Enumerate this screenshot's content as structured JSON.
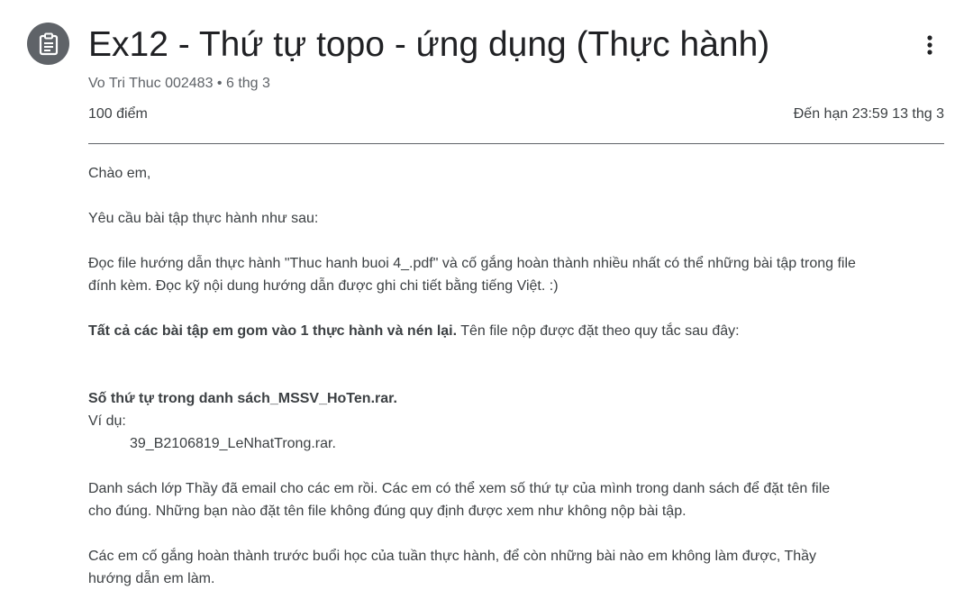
{
  "header": {
    "title": "Ex12 - Thứ tự topo - ứng dụng (Thực hành)",
    "author": "Vo Tri Thuc 002483",
    "separator": "•",
    "date": "6 thg 3",
    "points": "100 điểm",
    "due": "Đến hạn 23:59 13 thg 3",
    "icons": {
      "assignment": "assignment-icon",
      "more": "more-vert-icon"
    }
  },
  "body": {
    "greeting": "Chào em,",
    "request": "Yêu cầu bài tập thực hành như sau:",
    "para1_line1": "Đọc file hướng dẫn thực hành \"Thuc hanh buoi 4_.pdf\" và cố gắng hoàn thành nhiều nhất có thể những bài tập trong file",
    "para1_line2": "đính kèm. Đọc kỹ nội dung hướng dẫn được ghi chi tiết bằng tiếng Việt. :)",
    "para2_bold": "Tất cả các bài tập em gom vào 1 thực hành và nén lại.",
    "para2_rest": " Tên file nộp được đặt theo quy tắc sau đây:",
    "rule": "Số thứ tự trong danh sách_MSSV_HoTen.rar.",
    "example_label": "Ví dụ:",
    "example_value": "39_B2106819_LeNhatTrong.rar.",
    "para3_line1": "Danh sách lớp Thầy đã email cho các em rồi. Các em có thể xem số thứ tự của mình trong danh sách để đặt tên file",
    "para3_line2": "cho đúng. Những bạn nào đặt tên file không đúng quy định được xem như không nộp bài tập.",
    "para4_line1": "Các em cố gắng hoàn thành trước buổi học của tuần thực hành, để còn những bài nào em không làm được, Thầy",
    "para4_line2": "hướng dẫn em làm."
  },
  "colors": {
    "icon_bg": "#5f6368",
    "title": "#202124",
    "text": "#3c4043",
    "meta": "#5f6368"
  }
}
